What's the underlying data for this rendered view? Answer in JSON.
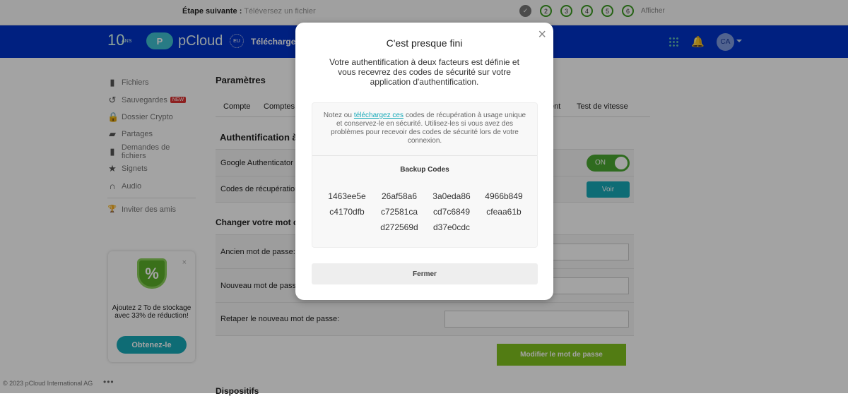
{
  "topbar": {
    "step_label": "Étape suivante :",
    "step_value": "Téléversez un fichier",
    "steps": [
      "✓",
      "2",
      "3",
      "4",
      "5",
      "6"
    ],
    "show": "Afficher"
  },
  "header": {
    "badge_num": "10",
    "badge_text": "ANS",
    "brand": "pCloud",
    "eu": "EU",
    "download": "Téléchargem",
    "avatar": "CA",
    "color": "#0033c8"
  },
  "sidebar": {
    "items": [
      {
        "icon": "file-icon",
        "glyph": "▮",
        "label": "Fichiers"
      },
      {
        "icon": "backup-icon",
        "glyph": "↺",
        "label": "Sauvegardes",
        "badge": "NEW"
      },
      {
        "icon": "lock-icon",
        "glyph": "🔒",
        "label": "Dossier Crypto"
      },
      {
        "icon": "share-icon",
        "glyph": "▰",
        "label": "Partages"
      },
      {
        "icon": "file-request-icon",
        "glyph": "▮",
        "label": "Demandes de fichiers"
      },
      {
        "icon": "star-icon",
        "glyph": "★",
        "label": "Signets"
      },
      {
        "icon": "headphones-icon",
        "glyph": "∩",
        "label": "Audio"
      },
      {
        "icon": "trophy-icon",
        "glyph": "🏆",
        "label": "Inviter des amis"
      }
    ]
  },
  "promo": {
    "symbol": "%",
    "text": "Ajoutez 2 To de stockage avec 33% de réduction!",
    "button": "Obtenez-le",
    "close": "×"
  },
  "footer": {
    "copyright": "© 2023 pCloud International AG",
    "more": "•••"
  },
  "settings": {
    "title": "Paramètres",
    "tabs": [
      "Compte",
      "Comptes a",
      "ent",
      "Test de vitesse"
    ],
    "twofa_title": "Authentification à d",
    "google": "Google Authenticator",
    "toggle": "ON",
    "recovery": "Codes de récupération",
    "view": "Voir",
    "password_title": "Changer votre mot de",
    "old": "Ancien mot de passe:",
    "new": "Nouveau mot de passe:",
    "retype": "Retaper le nouveau mot de passe:",
    "submit": "Modifier le mot de passe",
    "devices": "Dispositifs"
  },
  "modal": {
    "title": "C'est presque fini",
    "description": "Votre authentification à deux facteurs est définie et vous recevrez des codes de sécurité sur votre application d'authentification.",
    "note_before": "Notez ou",
    "note_link": "téléchargez ces",
    "note_after": "codes de récupération à usage unique et conservez-le en sécurité. Utilisez-les si vous avez des problèmes pour recevoir des codes de sécurité lors de votre connexion.",
    "codes_title": "Backup Codes",
    "codes": [
      "1463ee5e",
      "26af58a6",
      "3a0eda86",
      "4966b849",
      "c4170dfb",
      "c72581ca",
      "cd7c6849",
      "cfeaa61b",
      "",
      "d272569d",
      "d37e0cdc",
      ""
    ],
    "close_button": "Fermer",
    "close_icon": "×"
  }
}
